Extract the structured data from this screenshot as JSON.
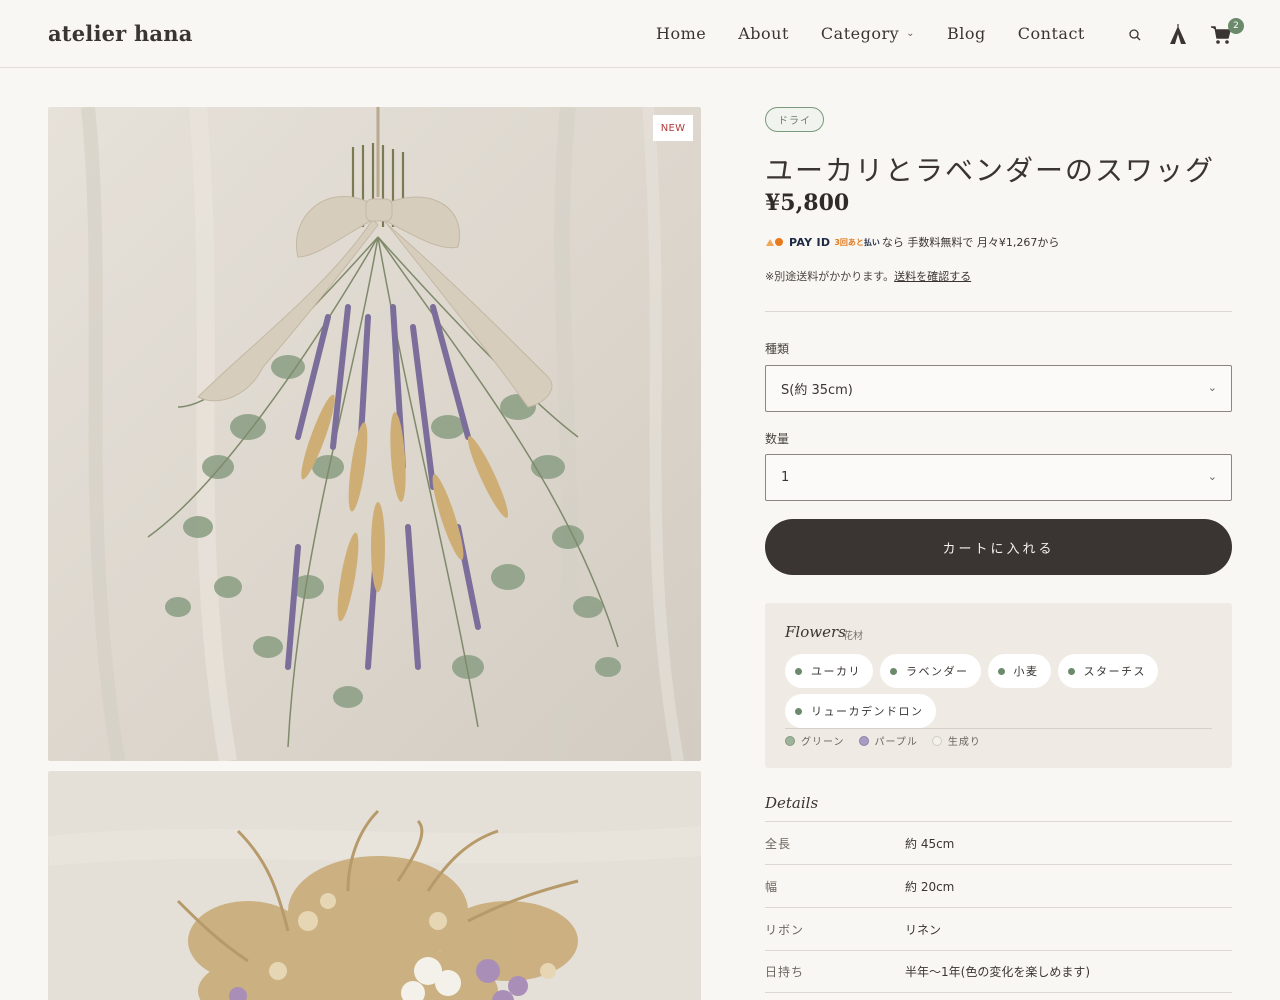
{
  "header": {
    "logo": "atelier hana",
    "nav": [
      "Home",
      "About",
      "Category",
      "Blog",
      "Contact"
    ],
    "cart_count": "2"
  },
  "gallery": {
    "new_badge": "NEW"
  },
  "product": {
    "tag": "ドライ",
    "title": "ユーカリとラベンダーのスワッグ",
    "price": "¥5,800",
    "pay_brand": "PAY ID",
    "pay_after_a": "3回あと",
    "pay_after_b": "払い",
    "pay_text": "なら 手数料無料で 月々¥1,267から",
    "shipping_text": "※別途送料がかかります。",
    "shipping_link": "送料を確認する"
  },
  "options": {
    "type_label": "種類",
    "type_value": "S(約 35cm)",
    "qty_label": "数量",
    "qty_value": "1",
    "cart_button": "カートに入れる"
  },
  "flowers": {
    "title": "Flowers",
    "subtitle": "花材",
    "items": [
      "ユーカリ",
      "ラベンダー",
      "小麦",
      "スターチス",
      "リューカデンドロン"
    ],
    "colors": [
      {
        "label": "グリーン",
        "hex": "#9db49a"
      },
      {
        "label": "パープル",
        "hex": "#a99ac6"
      },
      {
        "label": "生成り",
        "hex": "#f4f1ea"
      }
    ]
  },
  "details": {
    "title": "Details",
    "rows": [
      {
        "key": "全長",
        "value": "約 45cm"
      },
      {
        "key": "幅",
        "value": "約 20cm"
      },
      {
        "key": "リボン",
        "value": "リネン"
      },
      {
        "key": "日持ち",
        "value": "半年〜1年(色の変化を楽しめます)"
      }
    ]
  }
}
